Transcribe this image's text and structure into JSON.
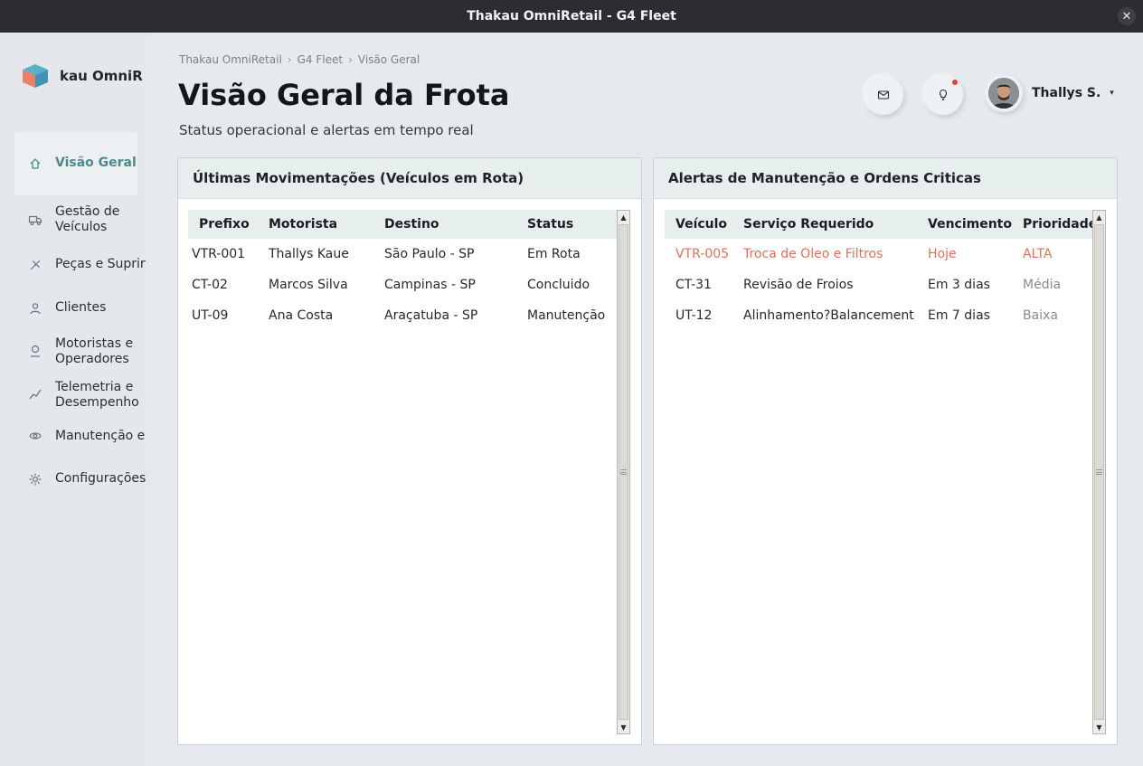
{
  "window": {
    "title": "Thakau OmniRetail - G4 Fleet",
    "close_glyph": "✕"
  },
  "brand": {
    "name": "kau OmniR"
  },
  "sidebar": {
    "items": [
      {
        "label": "Visão Geral",
        "icon": "home-icon"
      },
      {
        "label": "Gestão de Veículos",
        "line1": "Gestão de",
        "line2": "Veículos",
        "icon": "truck-icon"
      },
      {
        "label": "Peças e Suprir",
        "icon": "parts-icon"
      },
      {
        "label": "Clientes",
        "icon": "user-icon"
      },
      {
        "label": "Motoristas e Operadores",
        "line1": "Motoristas e",
        "line2": "Operadores",
        "icon": "driver-icon"
      },
      {
        "label": "Telemetria e Desempenho",
        "line1": "Telemetria e",
        "line2": "Desempenho",
        "icon": "chart-line-icon"
      },
      {
        "label": "Manutenção e",
        "icon": "maintenance-icon"
      },
      {
        "label": "Configurações",
        "icon": "gear-icon"
      }
    ]
  },
  "breadcrumb": {
    "items": [
      "Thakau OmniRetail",
      "G4 Fleet",
      "Visão Geral"
    ],
    "separator": "›"
  },
  "header": {
    "title": "Visão Geral da Frota",
    "subtitle": "Status operacional e alertas em tempo real",
    "user_name": "Thallys S.",
    "caret": "▾"
  },
  "movements": {
    "title": "Últimas Movimentações (Veículos em Rota)",
    "columns": [
      "Prefixo",
      "Motorista",
      "Destino",
      "Status"
    ],
    "rows": [
      [
        "VTR-001",
        "Thallys Kaue",
        "São Paulo - SP",
        "Em Rota"
      ],
      [
        "CT-02",
        "Marcos Silva",
        "Campinas - SP",
        "Concluido"
      ],
      [
        "UT-09",
        "Ana Costa",
        "Araçatuba - SP",
        "Manutenção"
      ]
    ]
  },
  "alerts": {
    "title": "Alertas de Manutenção e Ordens Criticas",
    "columns": [
      "Veículo",
      "Serviço Requerido",
      "Vencimento",
      "Prioridade"
    ],
    "rows": [
      [
        "VTR-005",
        "Troca de Óleo e Filtros",
        "Hoje",
        "ALTA"
      ],
      [
        "CT-31",
        "Revisão de Froios",
        "Em 3 dias",
        "Média"
      ],
      [
        "UT-12",
        "Alinhamento?Balancement",
        "Em 7 dias",
        "Baixa"
      ]
    ]
  },
  "scroll": {
    "up": "▲",
    "down": "▼"
  },
  "colors": {
    "accent": "#4d8a87",
    "critical": "#e0705a",
    "muted": "#858b91",
    "notification": "#d9433a"
  }
}
